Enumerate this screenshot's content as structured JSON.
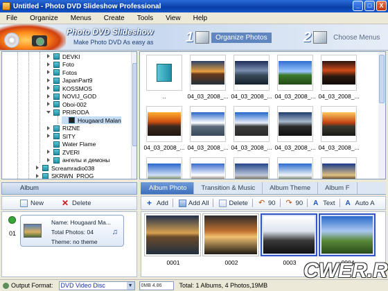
{
  "window": {
    "title": "Untitled - Photo DVD Slideshow Professional",
    "buttons": [
      "_",
      "□",
      "X"
    ]
  },
  "menu": [
    "File",
    "Organize",
    "Menus",
    "Create",
    "Tools",
    "View",
    "Help"
  ],
  "banner": {
    "title": "Photo DVD Slideshow",
    "subtitle": "Make Photo DVD As easy as",
    "step1": {
      "num": "1",
      "label": "Organize Photos"
    },
    "step2": {
      "num": "2",
      "label": "Choose Menus"
    }
  },
  "tree": {
    "items": [
      {
        "label": "DEVKI",
        "expand": "closed"
      },
      {
        "label": "Foto",
        "expand": "closed"
      },
      {
        "label": "Fotos",
        "expand": "closed"
      },
      {
        "label": "JapanPart9",
        "expand": "closed"
      },
      {
        "label": "KOSSMOS",
        "expand": "closed"
      },
      {
        "label": "NOVIJ_GOD",
        "expand": "closed"
      },
      {
        "label": "Oboi-002",
        "expand": "closed"
      },
      {
        "label": "PRIRODA",
        "expand": "open"
      },
      {
        "label": "Hougaard Malan",
        "expand": "none",
        "selected": true,
        "child": true
      },
      {
        "label": "RIZNE",
        "expand": "closed"
      },
      {
        "label": "SITY",
        "expand": "closed"
      },
      {
        "label": "Water Flame",
        "expand": "none"
      },
      {
        "label": "ZVERI",
        "expand": "closed"
      },
      {
        "label": "ангелы и демоны",
        "expand": "closed"
      },
      {
        "label": "Screamradio038",
        "expand": "closed",
        "outdent": true
      },
      {
        "label": "SKRWN_PROG",
        "expand": "closed",
        "outdent": true
      }
    ]
  },
  "grid": {
    "captions": [
      "..",
      "04_03_2008_...",
      "04_03_2008_...",
      "04_03_2008_...",
      "04_03_2008_...",
      "04_03_2008_...",
      "04_03_2008_...",
      "04_03_2008_...",
      "04_03_2008_...",
      "04_03_2008_...",
      "",
      "",
      "",
      "",
      ""
    ]
  },
  "album_panel": {
    "tab_label": "Album",
    "new_label": "New",
    "delete_label": "Delete",
    "album": {
      "index": "01",
      "name": "Name: Hougaard Ma...",
      "total": "Total Photos: 04",
      "theme": "Theme: no theme"
    }
  },
  "content_tabs": [
    "Album Photo",
    "Transition & Music",
    "Album Theme",
    "Album F"
  ],
  "content_toolbar": {
    "add": "Add",
    "add_all": "Add All",
    "delete": "Delete",
    "rotate_left": "90",
    "rotate_right": "90",
    "text": "Text",
    "auto": "Auto A"
  },
  "strip": {
    "items": [
      {
        "label": "0001"
      },
      {
        "label": "0002"
      },
      {
        "label": "0003",
        "selected": true
      },
      {
        "label": "0004",
        "selected": true
      }
    ]
  },
  "status": {
    "output_label": "Output Format:",
    "format": "DVD Video Disc",
    "capacity_text": "0MB    4.86",
    "capacity_fraction": 0.004,
    "totals": "Total: 1 Albums, 4 Photos,19MB"
  },
  "watermark": "CWER.RU",
  "colors": {
    "accent": "#3c6fbd",
    "title_bar": "#0a3fa8",
    "selection": "#3153c4"
  }
}
